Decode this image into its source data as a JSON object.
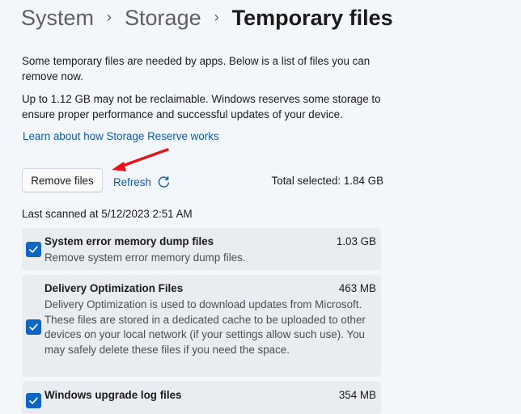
{
  "breadcrumb": {
    "items": [
      "System",
      "Storage",
      "Temporary files"
    ],
    "separator": "›"
  },
  "intro": {
    "text": "Some temporary files are needed by apps. Below is a list of files you can remove now.",
    "reserve_note": "Up to 1.12 GB may not be reclaimable. Windows reserves some storage to ensure proper performance and successful updates of your device.",
    "learn_link": "Learn about how Storage Reserve works"
  },
  "actions": {
    "remove_label": "Remove files",
    "refresh_label": "Refresh",
    "total_selected": "Total selected: 1.84 GB",
    "last_scanned": "Last scanned at 5/12/2023 2:51 AM"
  },
  "items": [
    {
      "title": "System error memory dump files",
      "size": "1.03 GB",
      "description": "Remove system error memory dump files.",
      "checked": true
    },
    {
      "title": "Delivery Optimization Files",
      "size": "463 MB",
      "description": "Delivery Optimization is used to download updates from Microsoft. These files are stored in a dedicated cache to be uploaded to other devices on your local network (if your settings allow such use). You may safely delete these files if you need the space.",
      "checked": true
    },
    {
      "title": "Windows upgrade log files",
      "size": "354 MB",
      "description": "",
      "checked": true
    }
  ],
  "colors": {
    "accent": "#0d66c2",
    "link": "#0b5cad",
    "annotation_arrow": "#e8141c",
    "background": "#f3f6fb",
    "card": "#e9ecf1"
  },
  "icons": {
    "refresh": "refresh-icon",
    "checkbox": "checkmark-icon",
    "annotation": "red-arrow-annotation"
  }
}
